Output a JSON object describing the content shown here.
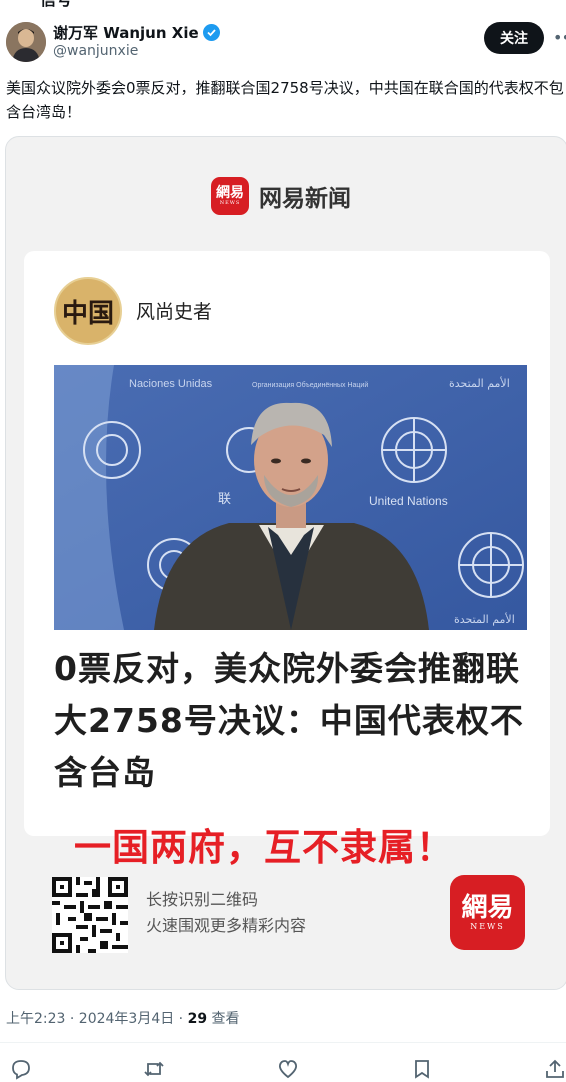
{
  "clipped_top_text": "信号",
  "author": {
    "display_name": "谢万军 Wanjun Xie",
    "handle": "@wanjunxie"
  },
  "follow_label": "关注",
  "tweet_text": "美国众议院外委会0票反对，推翻联合国2758号决议，中共国在联合国的代表权不包含台湾岛！",
  "card": {
    "brand": "网易新闻",
    "logo_text": "網易",
    "logo_sub": "NEWS",
    "author_avatar_text": "中国",
    "author_name": "风尚史者",
    "photo_texts": [
      "Naciones Unidas",
      "Организация Объединённых Наций",
      "الأمم المتحدة",
      "United Nations",
      "联",
      "الأمم المتحدة"
    ],
    "headline": "0票反对，美众院外委会推翻联大2758号决议：中国代表权不含台岛",
    "slogan": "一国两府，互不隶属！",
    "qr_text_1": "长按识别二维码",
    "qr_text_2": "火速围观更多精彩内容",
    "app_icon_text": "網易",
    "app_icon_sub": "NEWS"
  },
  "meta": {
    "time": "上午2:23 · 2024年3月4日 · ",
    "views": "29",
    "views_label": " 查看"
  },
  "actions": [
    "reply",
    "retweet",
    "like",
    "bookmark",
    "share"
  ],
  "colors": {
    "brand_red": "#d71e23",
    "slogan_red": "#e61f25",
    "verified_blue": "#1d9bf0",
    "un_blue": "#3d63a8"
  }
}
